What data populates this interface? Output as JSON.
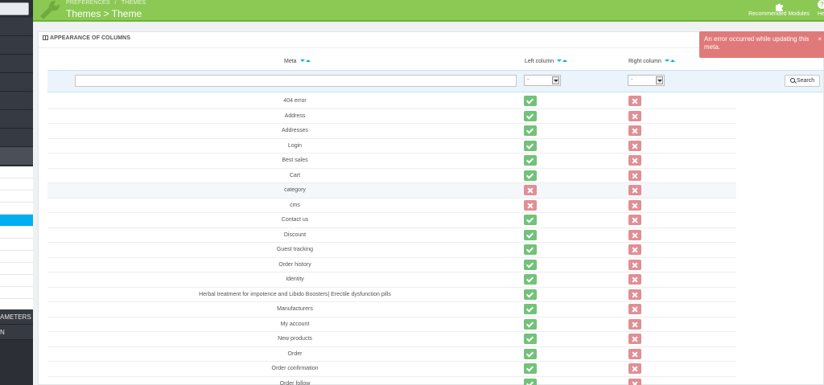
{
  "header": {
    "breadcrumb": [
      "PREFERENCES",
      "THEMES"
    ],
    "breadcrumb_sep": "/",
    "title": "Themes > Theme",
    "recommended_modules_label": "Recommended Modules",
    "help_label": "He",
    "help_icon_glyph": "?"
  },
  "sidebar": {
    "bottom_items": [
      "AMETERS",
      "N"
    ]
  },
  "panel": {
    "heading": "APPEARANCE OF COLUMNS"
  },
  "columns": {
    "meta": "Meta",
    "left": "Left column",
    "right": "Right column"
  },
  "filters": {
    "meta_value": "",
    "left_selected": "-",
    "right_selected": "-",
    "search_label": "Search"
  },
  "rows": [
    {
      "meta": "404 error",
      "left": true,
      "right": false
    },
    {
      "meta": "Address",
      "left": true,
      "right": false
    },
    {
      "meta": "Addresses",
      "left": true,
      "right": false
    },
    {
      "meta": "Login",
      "left": true,
      "right": false
    },
    {
      "meta": "Best sales",
      "left": true,
      "right": false
    },
    {
      "meta": "Cart",
      "left": true,
      "right": false
    },
    {
      "meta": "category",
      "left": false,
      "right": false
    },
    {
      "meta": "cms",
      "left": false,
      "right": false
    },
    {
      "meta": "Contact us",
      "left": true,
      "right": false
    },
    {
      "meta": "Discount",
      "left": true,
      "right": false
    },
    {
      "meta": "Guest tracking",
      "left": true,
      "right": false
    },
    {
      "meta": "Order history",
      "left": true,
      "right": false
    },
    {
      "meta": "Identity",
      "left": true,
      "right": false
    },
    {
      "meta": "Herbal treatment for impotence and Libido Boosters| Erectile dysfunction pills",
      "left": true,
      "right": false
    },
    {
      "meta": "Manufacturers",
      "left": true,
      "right": false
    },
    {
      "meta": "My account",
      "left": true,
      "right": false
    },
    {
      "meta": "New products",
      "left": true,
      "right": false
    },
    {
      "meta": "Order",
      "left": true,
      "right": false
    },
    {
      "meta": "Order confirmation",
      "left": true,
      "right": false
    },
    {
      "meta": "Order follow",
      "left": true,
      "right": false
    }
  ],
  "toast": {
    "message": "An error occurred while updating this meta.",
    "close": "×"
  },
  "colors": {
    "header_bg": "#8bc954",
    "sidebar_bg": "#2c2f36",
    "active_blue": "#00aff0",
    "enabled_green": "#72c279",
    "disabled_red": "#e08f95",
    "toast_bg": "#e07a7a"
  },
  "icons": {
    "header": "wrench-icon",
    "recommended": "puzzle-icon",
    "help": "help-icon",
    "search": "search-icon",
    "enabled": "check-icon",
    "disabled": "cross-icon"
  }
}
